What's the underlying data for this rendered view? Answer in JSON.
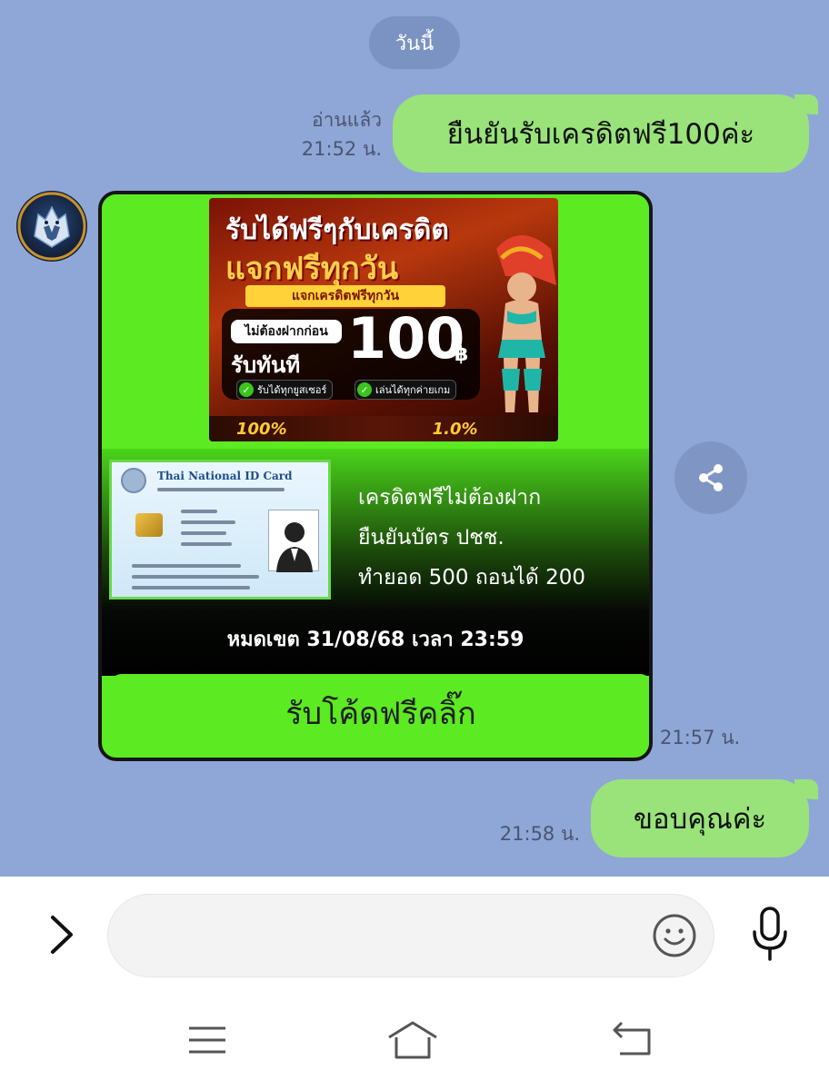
{
  "chat": {
    "date_label": "วันนี้",
    "messages": [
      {
        "side": "out",
        "text": "ยืนยันรับเครดิตฟรี100ค่ะ",
        "status": "อ่านแล้ว",
        "time": "21:52 น."
      },
      {
        "side": "in",
        "time": "21:57 น."
      },
      {
        "side": "out",
        "text": "ขอบคุณค่ะ",
        "time": "21:58 น."
      }
    ]
  },
  "promo_card": {
    "banner": {
      "title_line1": "รับได้ฟรีๆกับเครดิต",
      "title_line2": "แจกฟรีทุกวัน",
      "ribbon": "แจกเครดิตฟรีทุกวัน",
      "no_deposit": "ไม่ต้องฝากก่อน",
      "receive_now": "รับทันที",
      "amount": "100",
      "currency": "฿",
      "chip1": "รับได้ทุกยูสเซอร์",
      "chip2": "เล่นได้ทุกค่ายเกม",
      "stat1": "100%",
      "stat2": "1.0%"
    },
    "id_card": {
      "title": "Thai National ID Card"
    },
    "lines": [
      "เครดิตฟรีไม่ต้องฝาก",
      "ยืนยันบัตร ปชช.",
      "ทำยอด 500 ถอนได้ 200"
    ],
    "expiry": "หมดเขต 31/08/68 เวลา 23:59",
    "cta_label": "รับโค้ดฟรีคลิ๊ก"
  },
  "input": {
    "placeholder": ""
  },
  "colors": {
    "chat_bg": "#8fa7d6",
    "outgoing_bubble": "#99e37a",
    "card_green": "#5cea22"
  },
  "icons": {
    "expand": "chevron-right-icon",
    "emoji": "smiley-icon",
    "voice": "microphone-icon",
    "share": "share-icon",
    "nav_menu": "recent-apps-icon",
    "nav_home": "home-icon",
    "nav_back": "back-icon"
  }
}
